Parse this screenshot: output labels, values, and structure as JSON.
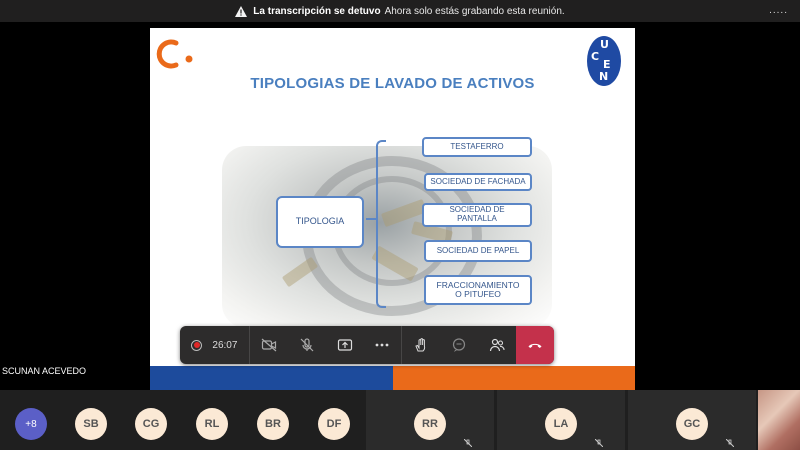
{
  "banner": {
    "bold_text": "La transcripción se detuvo",
    "text": "Ahora solo estás grabando esta reunión.",
    "more": "....."
  },
  "slide": {
    "title": "TIPOLOGIAS DE LAVADO DE ACTIVOS",
    "logo_letters": [
      "U",
      "C",
      "E",
      "N"
    ],
    "center_box": "TIPOLOGIA",
    "items": [
      "TESTAFERRO",
      "SOCIEDAD DE FACHADA",
      "SOCIEDAD DE PANTALLA",
      "SOCIEDAD DE PAPEL",
      "FRACCIONAMIENTO O PITUFEO"
    ],
    "colors": {
      "title": "#4a7fbf",
      "box_border": "#5b86c6",
      "footer_blue": "#1d4b9c",
      "footer_orange": "#ea6a1a"
    }
  },
  "controls": {
    "timer": "26:07",
    "buttons": [
      "camera-off-icon",
      "mic-off-icon",
      "share-icon",
      "more-icon",
      "raise-hand-icon",
      "chat-icon",
      "people-icon",
      "hang-up-icon"
    ]
  },
  "caller_name": "SCUNAN ACEVEDO",
  "participants": {
    "more_count": "+8",
    "initials": [
      "SB",
      "CG",
      "RL",
      "BR",
      "DF"
    ],
    "tiles": [
      "RR",
      "LA",
      "GC"
    ]
  }
}
